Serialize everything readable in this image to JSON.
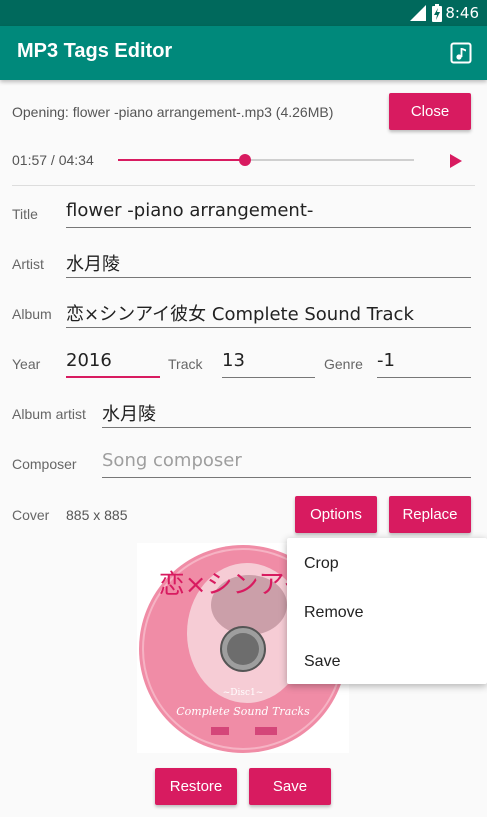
{
  "status_bar": {
    "time": "8:46"
  },
  "app_bar": {
    "title": "MP3 Tags Editor"
  },
  "file": {
    "opening_text": "Opening: flower -piano arrangement-.mp3 (4.26MB)",
    "close_label": "Close"
  },
  "player": {
    "time_text": "01:57 / 04:34",
    "progress": 0.43
  },
  "fields": {
    "title": {
      "label": "Title",
      "value": "flower -piano arrangement-"
    },
    "artist": {
      "label": "Artist",
      "value": "水月陵"
    },
    "album": {
      "label": "Album",
      "value": "恋×シンアイ彼女 Complete Sound Track"
    },
    "year": {
      "label": "Year",
      "value": "2016"
    },
    "track": {
      "label": "Track",
      "value": "13"
    },
    "genre": {
      "label": "Genre",
      "value": "-1"
    },
    "album_artist": {
      "label": "Album artist",
      "value": "水月陵"
    },
    "composer": {
      "label": "Composer",
      "placeholder": "Song composer"
    }
  },
  "cover": {
    "label": "Cover",
    "size": "885 x 885",
    "options_label": "Options",
    "replace_label": "Replace",
    "art_title": "恋×シンアイ彼",
    "art_subtitle": "Complete Sound Tracks",
    "art_disc": "~Disc1~"
  },
  "options_menu": {
    "items": [
      "Crop",
      "Remove",
      "Save"
    ]
  },
  "footer": {
    "restore_label": "Restore",
    "save_label": "Save"
  },
  "colors": {
    "accent": "#d81b60",
    "primary": "#00897b",
    "primary_dark": "#00695c"
  }
}
